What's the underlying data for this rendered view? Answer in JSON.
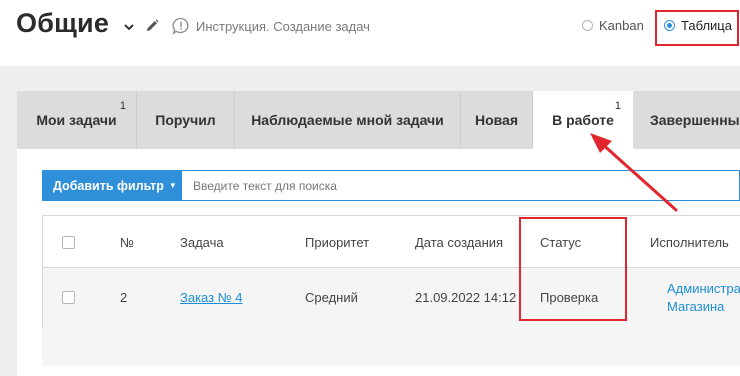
{
  "header": {
    "title": "Общие",
    "instruction": "Инструкция. Создание задач",
    "views": [
      {
        "label": "Kanban",
        "selected": false
      },
      {
        "label": "Таблица",
        "selected": true
      }
    ]
  },
  "tabs": [
    {
      "label": "Мои задачи",
      "badge": "1",
      "active": false
    },
    {
      "label": "Поручил",
      "badge": "",
      "active": false
    },
    {
      "label": "Наблюдаемые мной задачи",
      "badge": "",
      "active": false
    },
    {
      "label": "Новая",
      "badge": "",
      "active": false
    },
    {
      "label": "В работе",
      "badge": "1",
      "active": true
    },
    {
      "label": "Завершенные",
      "badge": "",
      "active": false
    }
  ],
  "filter": {
    "button_label": "Добавить фильтр",
    "search_placeholder": "Введите текст для поиска"
  },
  "table": {
    "columns": [
      "№",
      "Задача",
      "Приоритет",
      "Дата создания",
      "Статус",
      "Исполнитель"
    ],
    "rows": [
      {
        "number": "2",
        "task": "Заказ № 4",
        "priority": "Средний",
        "created": "21.09.2022 14:12",
        "status": "Проверка",
        "assignee_line1": "Администра",
        "assignee_line2": "Магазина"
      }
    ]
  },
  "colors": {
    "accent": "#2f8fd8",
    "link": "#1f8dd6",
    "annotation": "#e2262e",
    "tab_bg": "#dcdcdc",
    "page_gray": "#eeeeee"
  }
}
